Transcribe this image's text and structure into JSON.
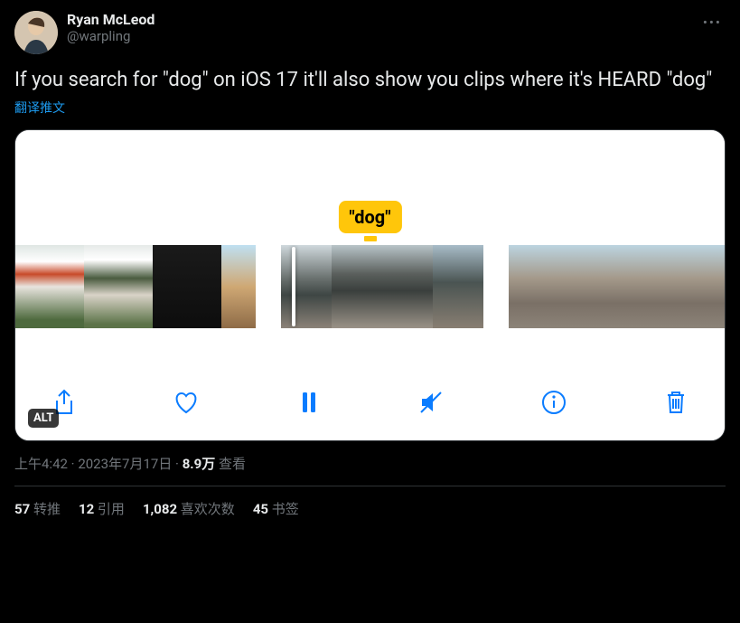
{
  "user": {
    "display_name": "Ryan McLeod",
    "handle": "@warpling"
  },
  "body_text": "If you search for \"dog\" on iOS 17 it'll also show you clips where it's HEARD \"dog\"",
  "translate_label": "翻译推文",
  "media": {
    "bubble_text": "\"dog\"",
    "alt_label": "ALT"
  },
  "meta": {
    "time": "上午4:42",
    "date": "2023年7月17日",
    "views_num": "8.9万",
    "views_label": "查看"
  },
  "stats": {
    "retweets_num": "57",
    "retweets_label": "转推",
    "quotes_num": "12",
    "quotes_label": "引用",
    "likes_num": "1,082",
    "likes_label": "喜欢次数",
    "bookmarks_num": "45",
    "bookmarks_label": "书签"
  }
}
